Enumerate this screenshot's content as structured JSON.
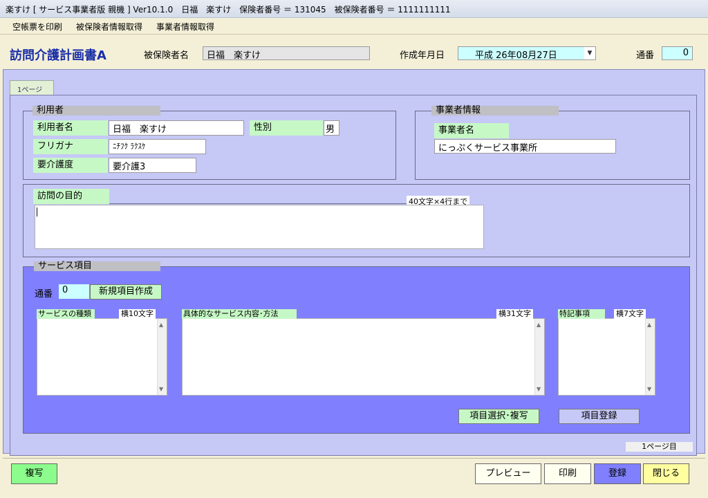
{
  "window": {
    "title": "楽すけ [ サービス事業者版 親機 ] Ver10.1.0　日福　楽すけ　保険者番号 ＝ 131045　被保険者番号 ＝ 1111111111"
  },
  "menu": {
    "items": [
      "空帳票を印刷",
      "被保険者情報取得",
      "事業者情報取得"
    ]
  },
  "header": {
    "doc_title": "訪問介護計画書A",
    "insured_name_label": "被保険者名",
    "insured_name_value": "日福　楽すけ",
    "created_date_label": "作成年月日",
    "created_date_value": "平成 26年08月27日",
    "serial_label": "通番",
    "serial_value": "0"
  },
  "tab": {
    "label": "1ページ"
  },
  "user_group": {
    "title": "利用者",
    "name_label": "利用者名",
    "name_value": "日福　楽すけ",
    "gender_label": "性別",
    "gender_value": "男",
    "furigana_label": "フリガナ",
    "furigana_value": "ﾆﾁﾌｸ ﾗｸｽｹ",
    "care_level_label": "要介護度",
    "care_level_value": "要介護3"
  },
  "provider_group": {
    "title": "事業者情報",
    "name_label": "事業者名",
    "name_value": "にっぷくサービス事業所"
  },
  "visit_purpose": {
    "label": "訪問の目的",
    "limit": "40文字×4行まで",
    "value": ""
  },
  "service_items": {
    "title": "サービス項目",
    "serial_label": "通番",
    "serial_value": "0",
    "new_item_button": "新規項目作成",
    "type_label": "サービスの種類",
    "type_limit": "横10文字",
    "content_label": "具体的なサービス内容･方法",
    "content_limit": "横31文字",
    "notes_label": "特記事項",
    "notes_limit": "横7文字",
    "select_copy_button": "項目選択･複写",
    "register_item_button": "項目登録"
  },
  "page_indicator": "1ページ目",
  "footer": {
    "copy_button": "複写",
    "preview_button": "プレビュー",
    "print_button": "印刷",
    "register_button": "登録",
    "close_button": "閉じる"
  }
}
